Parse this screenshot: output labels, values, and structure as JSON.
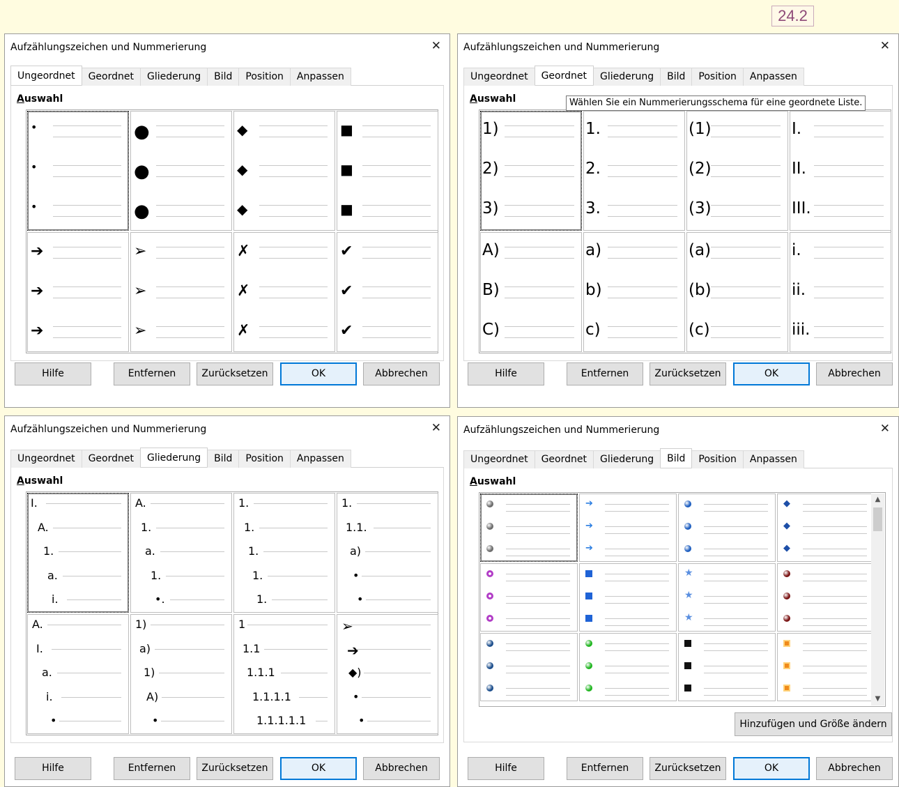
{
  "version_badge": "24.2",
  "dialogs": [
    {
      "title": "Aufzählungszeichen und Nummerierung",
      "active_tab": 0,
      "has_tooltip": false,
      "tooltip": "",
      "auswahl_label": "Auswahl",
      "buttons": {
        "help": "Hilfe",
        "remove": "Entfernen",
        "reset": "Zurücksetzen",
        "ok": "OK",
        "cancel": "Abbrechen"
      },
      "preset_kind": "bullets",
      "presets": [
        [
          "•",
          "•",
          "•"
        ],
        [
          "●",
          "●",
          "●"
        ],
        [
          "◆",
          "◆",
          "◆"
        ],
        [
          "■",
          "■",
          "■"
        ],
        [
          "➔",
          "➔",
          "➔"
        ],
        [
          "➢",
          "➢",
          "➢"
        ],
        [
          "✗",
          "✗",
          "✗"
        ],
        [
          "✔",
          "✔",
          "✔"
        ]
      ]
    },
    {
      "title": "Aufzählungszeichen und Nummerierung",
      "active_tab": 1,
      "has_tooltip": true,
      "tooltip": "Wählen Sie ein Nummerierungsschema für eine geordnete Liste.",
      "auswahl_label": "Auswahl",
      "buttons": {
        "help": "Hilfe",
        "remove": "Entfernen",
        "reset": "Zurücksetzen",
        "ok": "OK",
        "cancel": "Abbrechen"
      },
      "preset_kind": "numbering",
      "presets": [
        [
          "1)",
          "2)",
          "3)"
        ],
        [
          "1.",
          "2.",
          "3."
        ],
        [
          "(1)",
          "(2)",
          "(3)"
        ],
        [
          "I.",
          "II.",
          "III."
        ],
        [
          "A)",
          "B)",
          "C)"
        ],
        [
          "a)",
          "b)",
          "c)"
        ],
        [
          "(a)",
          "(b)",
          "(c)"
        ],
        [
          "i.",
          "ii.",
          "iii."
        ]
      ]
    },
    {
      "title": "Aufzählungszeichen und Nummerierung",
      "active_tab": 2,
      "has_tooltip": false,
      "tooltip": "",
      "auswahl_label": "Auswahl",
      "buttons": {
        "help": "Hilfe",
        "remove": "Entfernen",
        "reset": "Zurücksetzen",
        "ok": "OK",
        "cancel": "Abbrechen"
      },
      "preset_kind": "outline",
      "presets": [
        [
          "I.",
          "A.",
          "1.",
          "a.",
          "i."
        ],
        [
          "A.",
          "1.",
          "a.",
          "1.",
          "•."
        ],
        [
          "1.",
          "1.",
          "1.",
          "1.",
          "1."
        ],
        [
          "1.",
          "1.1.",
          "a)",
          "•",
          "•"
        ],
        [
          "A.",
          "I.",
          "a.",
          "i.",
          "•"
        ],
        [
          "1)",
          "a)",
          "1)",
          "A)",
          "•"
        ],
        [
          "1",
          "1.1",
          "1.1.1",
          "1.1.1.1",
          "1.1.1.1.1"
        ],
        [
          "➢",
          "➔",
          "◆)",
          "•",
          "•"
        ]
      ]
    },
    {
      "title": "Aufzählungszeichen und Nummerierung",
      "active_tab": 3,
      "has_tooltip": false,
      "tooltip": "",
      "auswahl_label": "Auswahl",
      "add_resize_button": "Hinzufügen und Größe ändern",
      "buttons": {
        "help": "Hilfe",
        "remove": "Entfernen",
        "reset": "Zurücksetzen",
        "ok": "OK",
        "cancel": "Abbrechen"
      },
      "preset_kind": "images",
      "presets": [
        {
          "icon": "gray-sphere-icon",
          "color": "#6d6d6d"
        },
        {
          "icon": "blue-arrow-icon",
          "color": "#2a7de1"
        },
        {
          "icon": "blue-sphere-icon",
          "color": "#1f5fc0"
        },
        {
          "icon": "blue-diamond-arrow-icon",
          "color": "#1d4fa8"
        },
        {
          "icon": "purple-ring-icon",
          "color": "#b23ec7"
        },
        {
          "icon": "blue-cube-icon",
          "color": "#1f63d6"
        },
        {
          "icon": "blue-star-icon",
          "color": "#5a8fe0"
        },
        {
          "icon": "dark-red-sphere-icon",
          "color": "#7a1414"
        },
        {
          "icon": "navy-sphere-icon",
          "color": "#1c4e8c"
        },
        {
          "icon": "green-sphere-icon",
          "color": "#1fb51f"
        },
        {
          "icon": "black-square-icon",
          "color": "#111111"
        },
        {
          "icon": "orange-square-icon",
          "color": "#f08a1a"
        }
      ]
    }
  ],
  "tabs": [
    "Ungeordnet",
    "Geordnet",
    "Gliederung",
    "Bild",
    "Position",
    "Anpassen"
  ],
  "accent_color": "#0078d7"
}
